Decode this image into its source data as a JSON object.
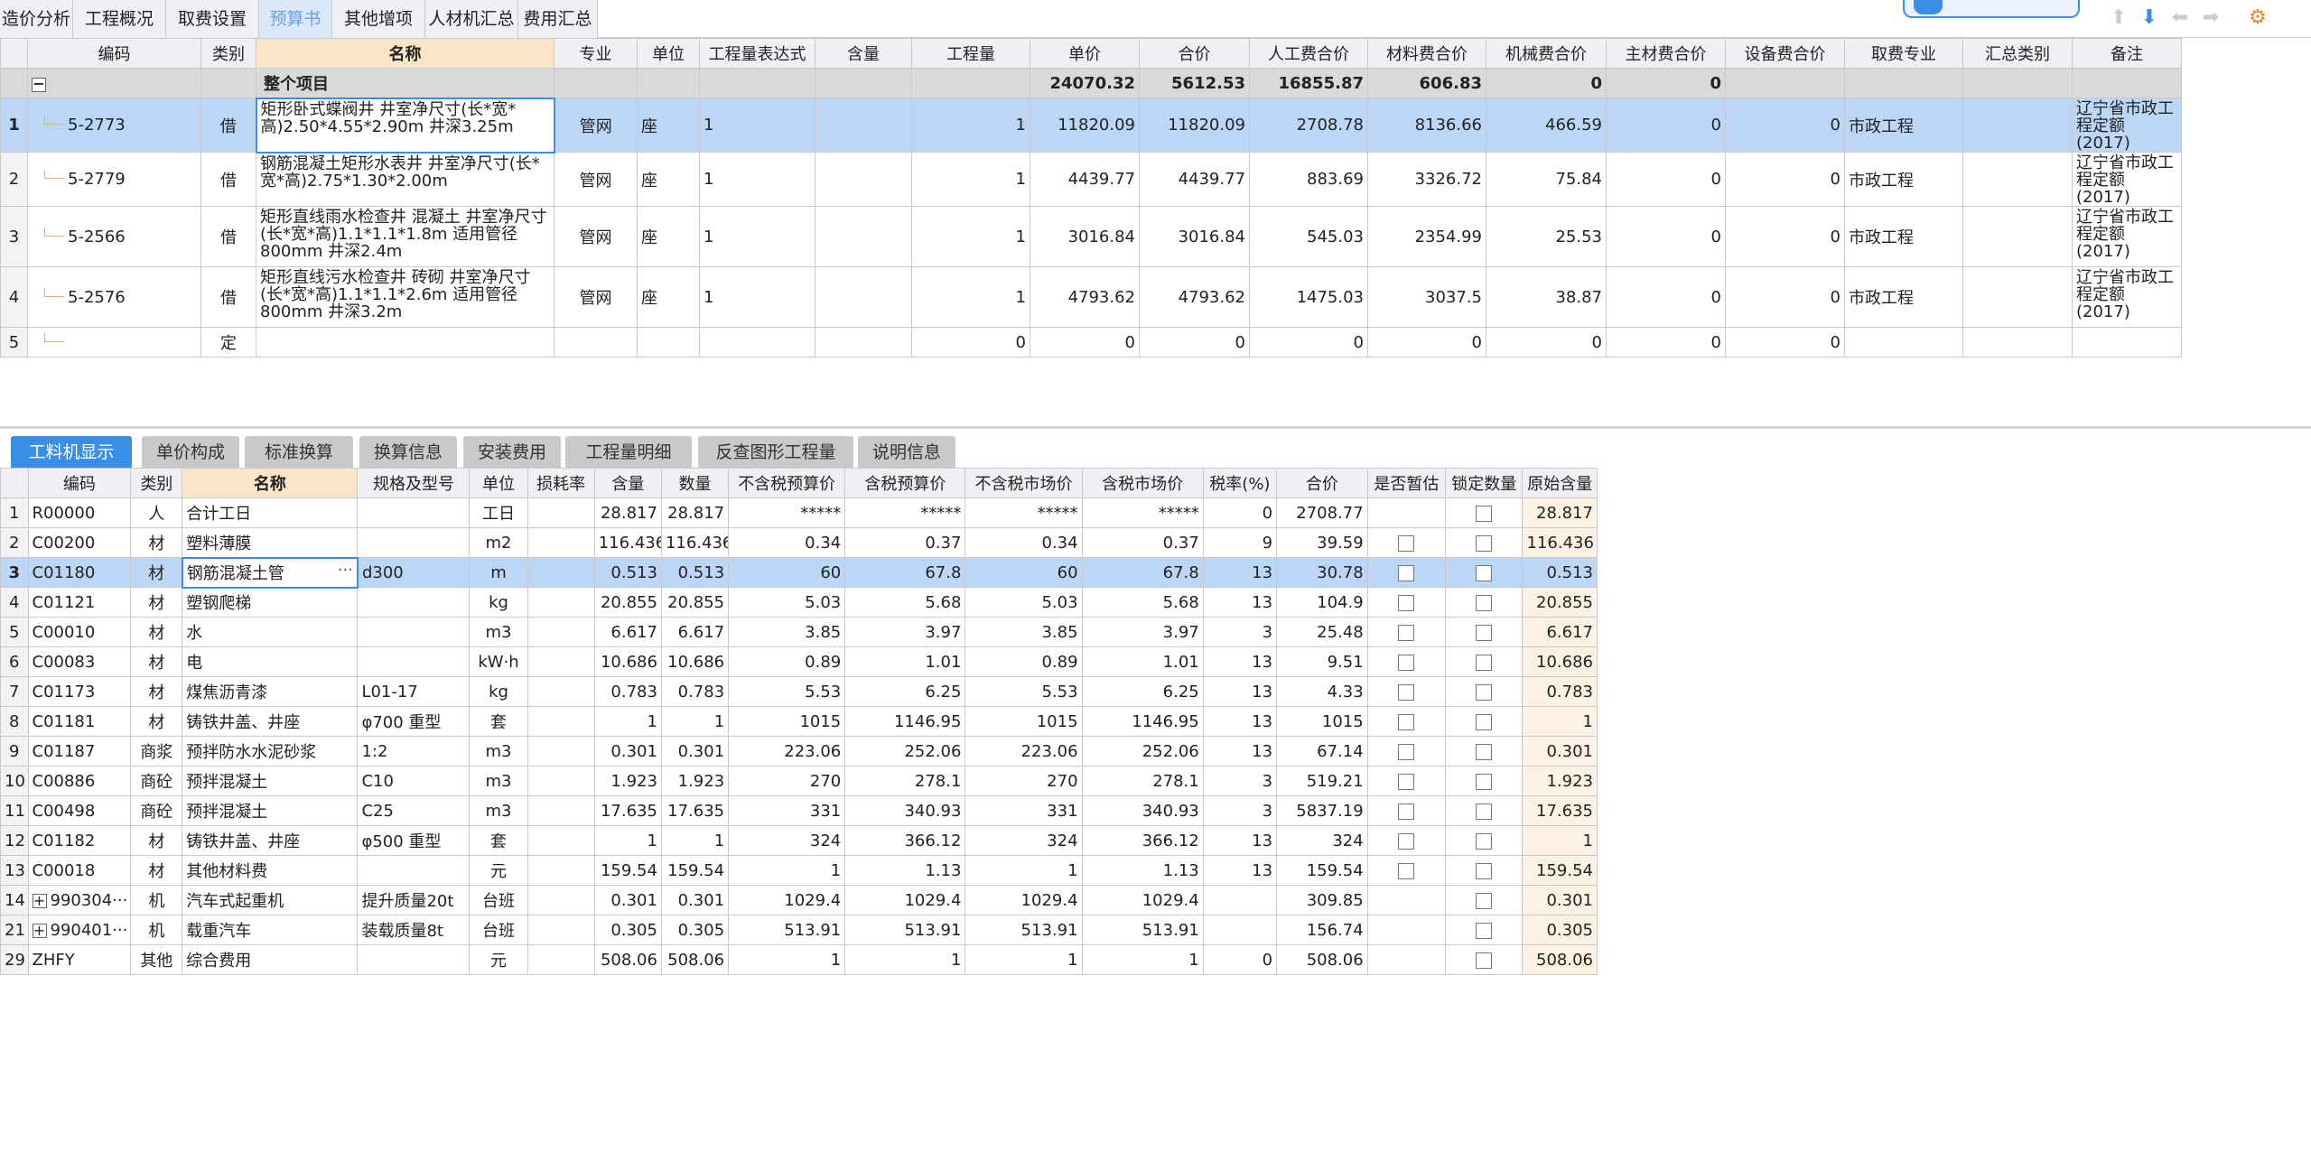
{
  "top_tabs": [
    "造价分析",
    "工程概况",
    "取费设置",
    "预算书",
    "其他增项",
    "人材机汇总",
    "费用汇总"
  ],
  "active_top_tab": "预算书",
  "toolbar_icons": [
    "arrow-up-icon",
    "arrow-down-icon",
    "arrow-left-icon",
    "arrow-right-icon",
    "settings-icon"
  ],
  "upper_headers": [
    "编码",
    "类别",
    "名称",
    "专业",
    "单位",
    "工程量表达式",
    "含量",
    "工程量",
    "单价",
    "合价",
    "人工费合价",
    "材料费合价",
    "机械费合价",
    "主材费合价",
    "设备费合价",
    "取费专业",
    "汇总类别",
    "备注"
  ],
  "summary": {
    "label": "整个项目",
    "hj": "24070.32",
    "rg": "5612.53",
    "cl": "16855.87",
    "jx": "606.83",
    "zc": "0",
    "sb": "0"
  },
  "upper_rows": [
    {
      "n": "1",
      "code": "5-2773",
      "lb": "借",
      "name": "矩形卧式蝶阀井 井室净尺寸(长*宽*高)2.50*4.55*2.90m 井深3.25m",
      "zy": "管网",
      "dw": "座",
      "expr": "1",
      "hl": "",
      "gcl": "1",
      "dj": "11820.09",
      "hj": "11820.09",
      "rg": "2708.78",
      "cl": "8136.66",
      "jx": "466.59",
      "zc": "0",
      "sb": "0",
      "qf": "市政工程",
      "hz": "",
      "bz": "辽宁省市政工程定额(2017)"
    },
    {
      "n": "2",
      "code": "5-2779",
      "lb": "借",
      "name": "钢筋混凝土矩形水表井 井室净尺寸(长*宽*高)2.75*1.30*2.00m",
      "zy": "管网",
      "dw": "座",
      "expr": "1",
      "hl": "",
      "gcl": "1",
      "dj": "4439.77",
      "hj": "4439.77",
      "rg": "883.69",
      "cl": "3326.72",
      "jx": "75.84",
      "zc": "0",
      "sb": "0",
      "qf": "市政工程",
      "hz": "",
      "bz": "辽宁省市政工程定额(2017)"
    },
    {
      "n": "3",
      "code": "5-2566",
      "lb": "借",
      "name": "矩形直线雨水检查井 混凝土 井室净尺寸(长*宽*高)1.1*1.1*1.8m 适用管径800mm 井深2.4m",
      "zy": "管网",
      "dw": "座",
      "expr": "1",
      "hl": "",
      "gcl": "1",
      "dj": "3016.84",
      "hj": "3016.84",
      "rg": "545.03",
      "cl": "2354.99",
      "jx": "25.53",
      "zc": "0",
      "sb": "0",
      "qf": "市政工程",
      "hz": "",
      "bz": "辽宁省市政工程定额(2017)"
    },
    {
      "n": "4",
      "code": "5-2576",
      "lb": "借",
      "name": "矩形直线污水检查井 砖砌 井室净尺寸(长*宽*高)1.1*1.1*2.6m 适用管径800mm 井深3.2m",
      "zy": "管网",
      "dw": "座",
      "expr": "1",
      "hl": "",
      "gcl": "1",
      "dj": "4793.62",
      "hj": "4793.62",
      "rg": "1475.03",
      "cl": "3037.5",
      "jx": "38.87",
      "zc": "0",
      "sb": "0",
      "qf": "市政工程",
      "hz": "",
      "bz": "辽宁省市政工程定额(2017)"
    },
    {
      "n": "5",
      "code": "",
      "lb": "定",
      "name": "",
      "zy": "",
      "dw": "",
      "expr": "",
      "hl": "",
      "gcl": "0",
      "dj": "0",
      "hj": "0",
      "rg": "0",
      "cl": "0",
      "jx": "0",
      "zc": "0",
      "sb": "0",
      "qf": "",
      "hz": "",
      "bz": ""
    }
  ],
  "bottom_tabs": [
    "工料机显示",
    "单价构成",
    "标准换算",
    "换算信息",
    "安装费用",
    "工程量明细",
    "反查图形工程量",
    "说明信息"
  ],
  "active_bottom_tab": "工料机显示",
  "lower_headers": [
    "编码",
    "类别",
    "名称",
    "规格及型号",
    "单位",
    "损耗率",
    "含量",
    "数量",
    "不含税预算价",
    "含税预算价",
    "不含税市场价",
    "含税市场价",
    "税率(%)",
    "合价",
    "是否暂估",
    "锁定数量",
    "原始含量"
  ],
  "lower_rows": [
    {
      "n": "1",
      "code": "R00000",
      "lb": "人",
      "name": "合计工日",
      "gg": "",
      "dw": "工日",
      "sh": "",
      "hl": "28.817",
      "sl": "28.817",
      "bys": "*****",
      "hys": "*****",
      "bsc": "*****",
      "hsc": "*****",
      "sv": "0",
      "hj": "2708.77",
      "zg": false,
      "yh": "28.817"
    },
    {
      "n": "2",
      "code": "C00200",
      "lb": "材",
      "name": "塑料薄膜",
      "gg": "",
      "dw": "m2",
      "sh": "",
      "hl": "116.436",
      "sl": "116.436",
      "bys": "0.34",
      "hys": "0.37",
      "bsc": "0.34",
      "hsc": "0.37",
      "sv": "9",
      "hj": "39.59",
      "zg": true,
      "yh": "116.436"
    },
    {
      "n": "3",
      "code": "C01180",
      "lb": "材",
      "name": "钢筋混凝土管",
      "gg": "d300",
      "dw": "m",
      "sh": "",
      "hl": "0.513",
      "sl": "0.513",
      "bys": "60",
      "hys": "67.8",
      "bsc": "60",
      "hsc": "67.8",
      "sv": "13",
      "hj": "30.78",
      "zg": true,
      "yh": "0.513"
    },
    {
      "n": "4",
      "code": "C01121",
      "lb": "材",
      "name": "塑钢爬梯",
      "gg": "",
      "dw": "kg",
      "sh": "",
      "hl": "20.855",
      "sl": "20.855",
      "bys": "5.03",
      "hys": "5.68",
      "bsc": "5.03",
      "hsc": "5.68",
      "sv": "13",
      "hj": "104.9",
      "zg": true,
      "yh": "20.855"
    },
    {
      "n": "5",
      "code": "C00010",
      "lb": "材",
      "name": "水",
      "gg": "",
      "dw": "m3",
      "sh": "",
      "hl": "6.617",
      "sl": "6.617",
      "bys": "3.85",
      "hys": "3.97",
      "bsc": "3.85",
      "hsc": "3.97",
      "sv": "3",
      "hj": "25.48",
      "zg": true,
      "yh": "6.617"
    },
    {
      "n": "6",
      "code": "C00083",
      "lb": "材",
      "name": "电",
      "gg": "",
      "dw": "kW·h",
      "sh": "",
      "hl": "10.686",
      "sl": "10.686",
      "bys": "0.89",
      "hys": "1.01",
      "bsc": "0.89",
      "hsc": "1.01",
      "sv": "13",
      "hj": "9.51",
      "zg": true,
      "yh": "10.686"
    },
    {
      "n": "7",
      "code": "C01173",
      "lb": "材",
      "name": "煤焦沥青漆",
      "gg": "L01-17",
      "dw": "kg",
      "sh": "",
      "hl": "0.783",
      "sl": "0.783",
      "bys": "5.53",
      "hys": "6.25",
      "bsc": "5.53",
      "hsc": "6.25",
      "sv": "13",
      "hj": "4.33",
      "zg": true,
      "yh": "0.783"
    },
    {
      "n": "8",
      "code": "C01181",
      "lb": "材",
      "name": "铸铁井盖、井座",
      "gg": "φ700 重型",
      "dw": "套",
      "sh": "",
      "hl": "1",
      "sl": "1",
      "bys": "1015",
      "hys": "1146.95",
      "bsc": "1015",
      "hsc": "1146.95",
      "sv": "13",
      "hj": "1015",
      "zg": true,
      "yh": "1"
    },
    {
      "n": "9",
      "code": "C01187",
      "lb": "商浆",
      "name": "预拌防水水泥砂浆",
      "gg": "1:2",
      "dw": "m3",
      "sh": "",
      "hl": "0.301",
      "sl": "0.301",
      "bys": "223.06",
      "hys": "252.06",
      "bsc": "223.06",
      "hsc": "252.06",
      "sv": "13",
      "hj": "67.14",
      "zg": true,
      "yh": "0.301"
    },
    {
      "n": "10",
      "code": "C00886",
      "lb": "商砼",
      "name": "预拌混凝土",
      "gg": "C10",
      "dw": "m3",
      "sh": "",
      "hl": "1.923",
      "sl": "1.923",
      "bys": "270",
      "hys": "278.1",
      "bsc": "270",
      "hsc": "278.1",
      "sv": "3",
      "hj": "519.21",
      "zg": true,
      "yh": "1.923"
    },
    {
      "n": "11",
      "code": "C00498",
      "lb": "商砼",
      "name": "预拌混凝土",
      "gg": "C25",
      "dw": "m3",
      "sh": "",
      "hl": "17.635",
      "sl": "17.635",
      "bys": "331",
      "hys": "340.93",
      "bsc": "331",
      "hsc": "340.93",
      "sv": "3",
      "hj": "5837.19",
      "zg": true,
      "yh": "17.635"
    },
    {
      "n": "12",
      "code": "C01182",
      "lb": "材",
      "name": "铸铁井盖、井座",
      "gg": "φ500 重型",
      "dw": "套",
      "sh": "",
      "hl": "1",
      "sl": "1",
      "bys": "324",
      "hys": "366.12",
      "bsc": "324",
      "hsc": "366.12",
      "sv": "13",
      "hj": "324",
      "zg": true,
      "yh": "1"
    },
    {
      "n": "13",
      "code": "C00018",
      "lb": "材",
      "name": "其他材料费",
      "gg": "",
      "dw": "元",
      "sh": "",
      "hl": "159.54",
      "sl": "159.54",
      "bys": "1",
      "hys": "1.13",
      "bsc": "1",
      "hsc": "1.13",
      "sv": "13",
      "hj": "159.54",
      "zg": true,
      "yh": "159.54"
    },
    {
      "n": "14",
      "code": "990304···",
      "lb": "机",
      "name": "汽车式起重机",
      "gg": "提升质量20t",
      "dw": "台班",
      "sh": "",
      "hl": "0.301",
      "sl": "0.301",
      "bys": "1029.4",
      "hys": "1029.4",
      "bsc": "1029.4",
      "hsc": "1029.4",
      "sv": "",
      "hj": "309.85",
      "zg": false,
      "yh": "0.301",
      "exp": true
    },
    {
      "n": "21",
      "code": "990401···",
      "lb": "机",
      "name": "载重汽车",
      "gg": "装载质量8t",
      "dw": "台班",
      "sh": "",
      "hl": "0.305",
      "sl": "0.305",
      "bys": "513.91",
      "hys": "513.91",
      "bsc": "513.91",
      "hsc": "513.91",
      "sv": "",
      "hj": "156.74",
      "zg": false,
      "yh": "0.305",
      "exp": true
    },
    {
      "n": "29",
      "code": "ZHFY",
      "lb": "其他",
      "name": "综合费用",
      "gg": "",
      "dw": "元",
      "sh": "",
      "hl": "508.06",
      "sl": "508.06",
      "bys": "1",
      "hys": "1",
      "bsc": "1",
      "hsc": "1",
      "sv": "0",
      "hj": "508.06",
      "zg": false,
      "yh": "508.06"
    }
  ]
}
